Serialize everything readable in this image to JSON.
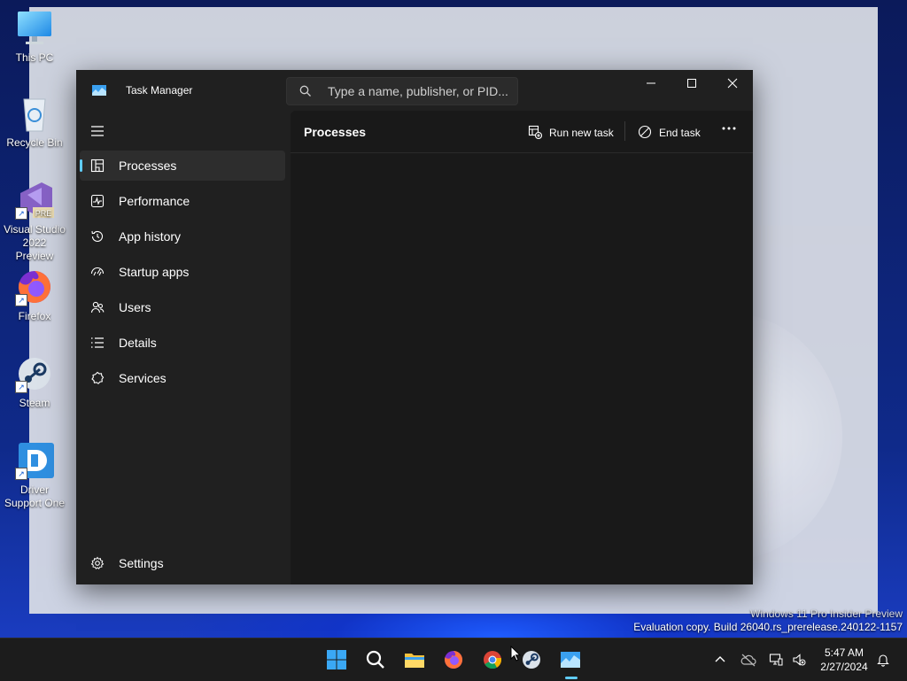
{
  "desktop": {
    "icons": [
      {
        "label": "This PC"
      },
      {
        "label": "Recycle Bin"
      },
      {
        "label": "Visual Studio 2022 Preview",
        "badge": "PRE"
      },
      {
        "label": "Firefox"
      },
      {
        "label": "Steam"
      },
      {
        "label": "Driver Support One"
      }
    ]
  },
  "task_manager": {
    "title": "Task Manager",
    "search": {
      "value": "",
      "placeholder": "Type a name, publisher, or PID..."
    },
    "nav": {
      "items": [
        {
          "label": "Processes",
          "icon": "processes-icon",
          "active": true
        },
        {
          "label": "Performance",
          "icon": "performance-icon"
        },
        {
          "label": "App history",
          "icon": "app-history-icon"
        },
        {
          "label": "Startup apps",
          "icon": "startup-apps-icon"
        },
        {
          "label": "Users",
          "icon": "users-icon"
        },
        {
          "label": "Details",
          "icon": "details-icon"
        },
        {
          "label": "Services",
          "icon": "services-icon"
        }
      ],
      "settings_label": "Settings"
    },
    "content": {
      "title": "Processes",
      "run_new_task_label": "Run new task",
      "end_task_label": "End task"
    }
  },
  "watermark": {
    "line1": "Windows 11 Pro Insider Preview",
    "line2": "Evaluation copy. Build 26040.rs_prerelease.240122-1157"
  },
  "taskbar": {
    "time": "5:47 AM",
    "date": "2/27/2024"
  },
  "colors": {
    "accent": "#60cdff",
    "window_bg": "#202020",
    "content_bg": "#191919",
    "taskbar_bg": "#1c1c1c"
  }
}
